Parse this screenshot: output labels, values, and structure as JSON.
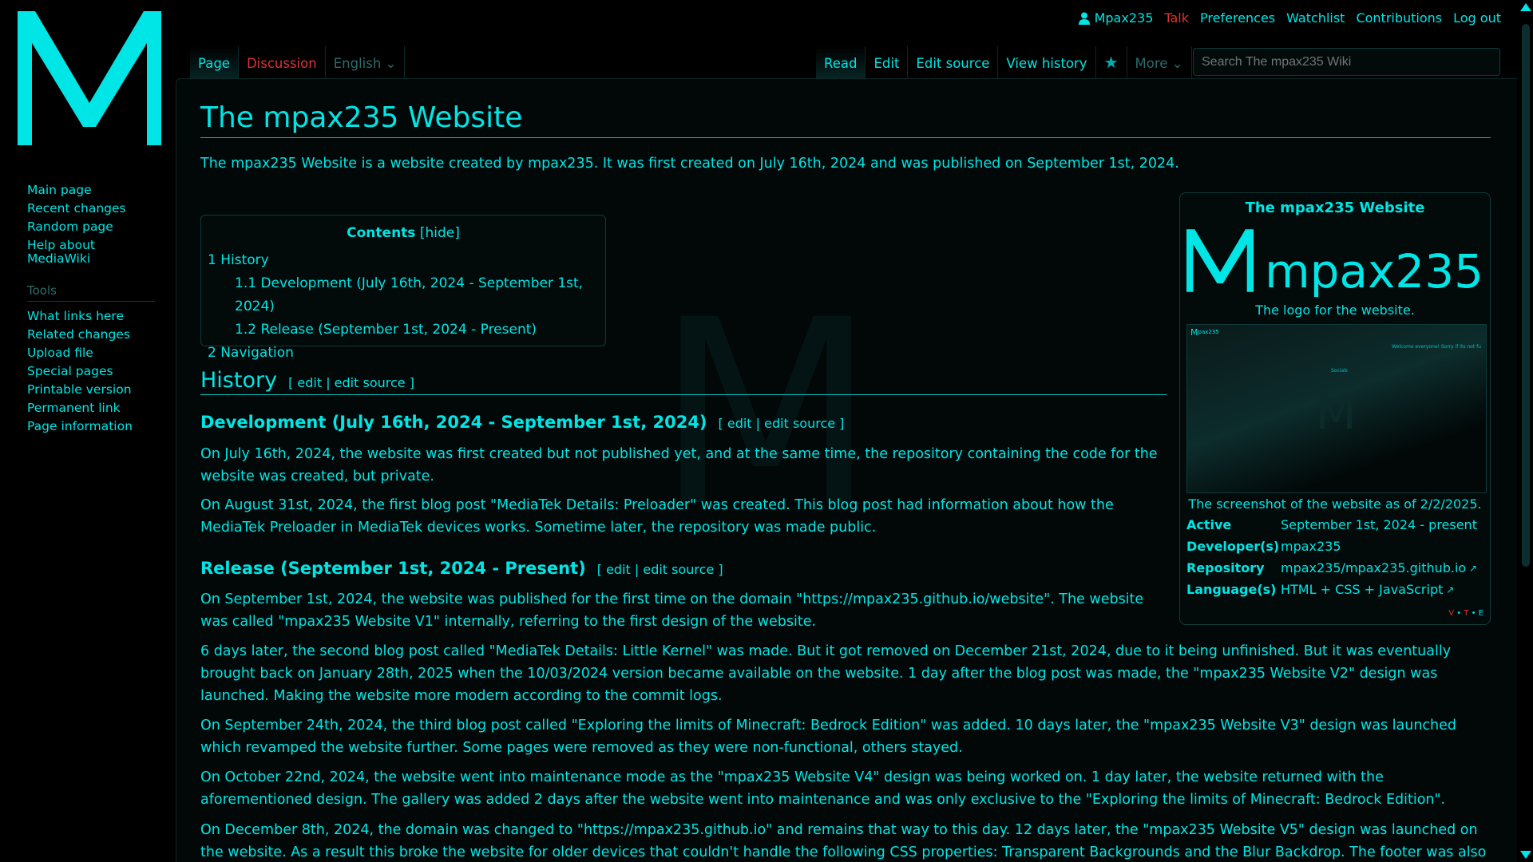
{
  "personal": {
    "username": "Mpax235",
    "talk": "Talk",
    "preferences": "Preferences",
    "watchlist": "Watchlist",
    "contributions": "Contributions",
    "logout": "Log out"
  },
  "tabs": {
    "page": "Page",
    "discussion": "Discussion",
    "language": "English",
    "read": "Read",
    "edit": "Edit",
    "edit_source": "Edit source",
    "history": "View history",
    "more": "More"
  },
  "search": {
    "placeholder": "Search The mpax235 Wiki"
  },
  "sidebar": {
    "nav": [
      "Main page",
      "Recent changes",
      "Random page",
      "Help about MediaWiki"
    ],
    "tools_heading": "Tools",
    "tools": [
      "What links here",
      "Related changes",
      "Upload file",
      "Special pages",
      "Printable version",
      "Permanent link",
      "Page information"
    ]
  },
  "article": {
    "title": "The mpax235 Website",
    "intro": "The mpax235 Website is a website created by mpax235. It was first created on July 16th, 2024 and was published on September 1st, 2024.",
    "toc": {
      "title": "Contents",
      "hide": "[hide]",
      "items": [
        "1  History",
        "1.1  Development (July 16th, 2024 - September 1st, 2024)",
        "1.2  Release (September 1st, 2024 - Present)",
        "2  Navigation"
      ]
    },
    "edit_links": "[ edit | edit source ]",
    "h2_history": "History",
    "h3_dev": "Development (July 16th, 2024 - September 1st, 2024)",
    "dev_p1": "On July 16th, 2024, the website was first created but not published yet, and at the same time, the repository containing the code for the website was created, but private.",
    "dev_p2": "On August 31st, 2024, the first blog post \"MediaTek Details: Preloader\" was created. This blog post had information about how the MediaTek Preloader in MediaTek devices works. Sometime later, the repository was made public.",
    "h3_release": "Release (September 1st, 2024 - Present)",
    "rel_p1": "On September 1st, 2024, the website was published for the first time on the domain \"https://mpax235.github.io/website\". The website was called \"mpax235 Website V1\" internally, referring to the first design of the website.",
    "rel_p2": "6 days later, the second blog post called \"MediaTek Details: Little Kernel\" was made. But it got removed on December 21st, 2024, due to it being unfinished. But it was eventually brought back on January 28th, 2025 when the 10/03/2024 version became available on the website. 1 day after the blog post was made, the \"mpax235 Website V2\" design was launched. Making the website more modern according to the commit logs.",
    "rel_p3": "On September 24th, 2024, the third blog post called \"Exploring the limits of Minecraft: Bedrock Edition\" was added. 10 days later, the \"mpax235 Website V3\" design was launched which revamped the website further. Some pages were removed as they were non-functional, others stayed.",
    "rel_p4": "On October 22nd, 2024, the website went into maintenance mode as the \"mpax235 Website V4\" design was being worked on. 1 day later, the website returned with the aforementioned design. The gallery was added 2 days after the website went into maintenance and was only exclusive to the \"Exploring the limits of Minecraft: Bedrock Edition\".",
    "rel_p5": "On December 8th, 2024, the domain was changed to \"https://mpax235.github.io\" and remains that way to this day. 12 days later, the \"mpax235 Website V5\" design was launched on the website. As a result this broke the website for older devices that couldn't handle the following CSS properties: Transparent Backgrounds and the Blur Backdrop. The footer was also"
  },
  "infobox": {
    "title": "The mpax235 Website",
    "logo_word": "mpax235",
    "logo_caption": "The logo for the website.",
    "shot_caption": "The screenshot of the website as of 2/2/2025.",
    "shot_welcome": "Welcome everyone! Sorry if its not fu",
    "shot_socials": "Socials",
    "rows": [
      {
        "k": "Active",
        "v": "September 1st, 2024 - present"
      },
      {
        "k": "Developer(s)",
        "v": "mpax235"
      },
      {
        "k": "Repository",
        "v": "mpax235/mpax235.github.io"
      },
      {
        "k": "Language(s)",
        "v": "HTML + CSS + JavaScript"
      }
    ],
    "vte_v": "V",
    "vte_t": "T",
    "vte_e": "E"
  },
  "colors": {
    "accent": "#00e5e5",
    "red": "#dd3333",
    "muted": "#2e6b6b",
    "bg": "#000000"
  }
}
